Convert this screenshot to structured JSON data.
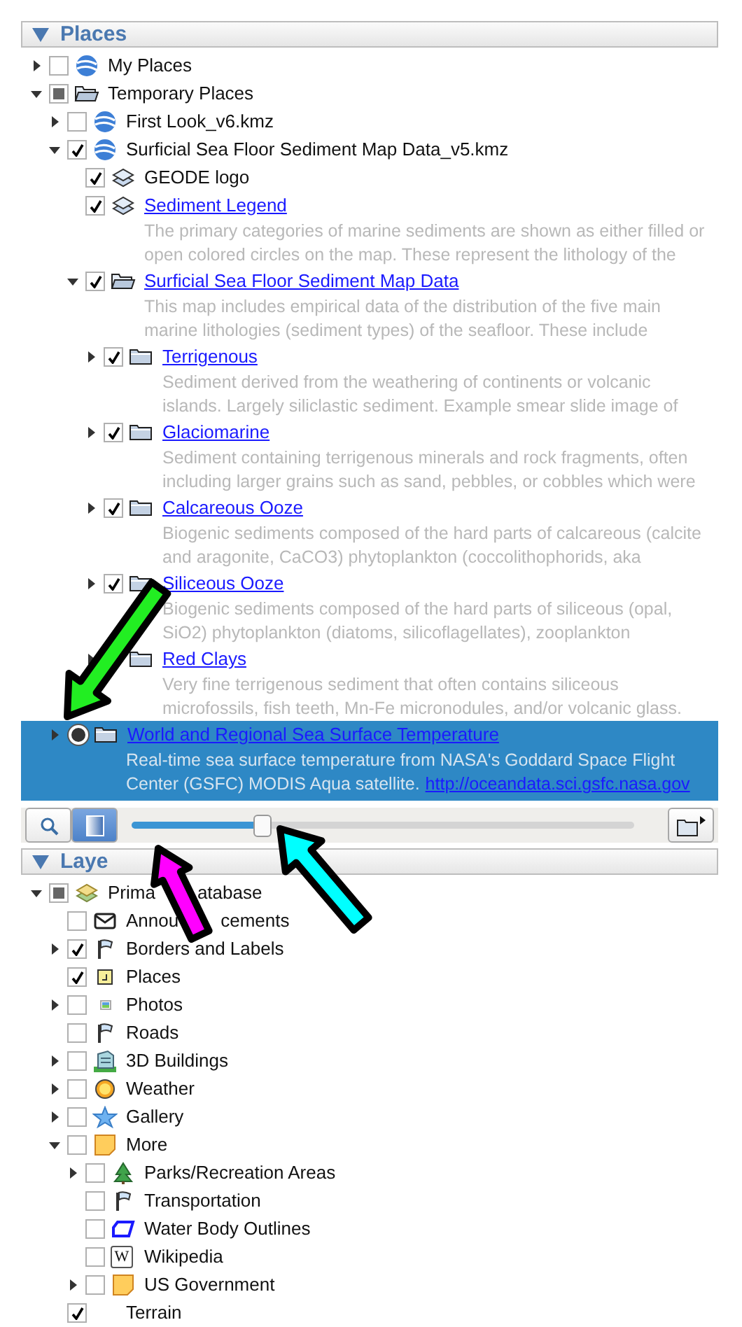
{
  "places": {
    "title": "Places",
    "expanded": true,
    "items": [
      {
        "label": "My Places",
        "kind": "globe",
        "expandable": true,
        "expanded": false,
        "checked": false,
        "link": false,
        "selected": false
      },
      {
        "label": "Temporary Places",
        "kind": "folder-open",
        "expandable": true,
        "expanded": true,
        "mixed": true,
        "link": false,
        "selected": false,
        "children": [
          {
            "label": "First Look_v6.kmz",
            "kind": "globe",
            "expandable": true,
            "expanded": false,
            "checked": false,
            "link": false,
            "selected": false
          },
          {
            "label": "Surficial Sea Floor Sediment Map Data_v5.kmz",
            "kind": "globe",
            "expandable": true,
            "expanded": true,
            "checked": true,
            "link": false,
            "selected": false,
            "children": [
              {
                "label": "GEODE logo",
                "kind": "layers",
                "expandable": false,
                "expanded": false,
                "checked": true,
                "link": false,
                "selected": false
              },
              {
                "label": "Sediment Legend",
                "kind": "layers",
                "expandable": false,
                "expanded": false,
                "checked": true,
                "link": true,
                "selected": false,
                "description": [
                  "The primary categories of marine sediments are shown as either filled or",
                  "open colored circles on the map. These represent the lithology of the"
                ]
              },
              {
                "label": "Surficial Sea Floor Sediment Map Data",
                "kind": "folder-open",
                "expandable": true,
                "expanded": true,
                "checked": true,
                "link": true,
                "selected": false,
                "description": [
                  "This map includes empirical data of the distribution of the five main",
                  "marine lithologies (sediment types) of the seafloor. These include"
                ],
                "children": [
                  {
                    "label": "Terrigenous",
                    "kind": "folder",
                    "expandable": true,
                    "expanded": false,
                    "checked": true,
                    "link": true,
                    "selected": false,
                    "description": [
                      "Sediment derived from the weathering of continents or volcanic",
                      "islands. Largely siliclastic sediment. Example smear slide image of"
                    ]
                  },
                  {
                    "label": "Glaciomarine",
                    "kind": "folder",
                    "expandable": true,
                    "expanded": false,
                    "checked": true,
                    "link": true,
                    "selected": false,
                    "description": [
                      "Sediment containing terrigenous minerals and rock fragments, often",
                      "including larger grains such as sand, pebbles, or cobbles which were"
                    ]
                  },
                  {
                    "label": "Calcareous Ooze",
                    "kind": "folder",
                    "expandable": true,
                    "expanded": false,
                    "checked": true,
                    "link": true,
                    "selected": false,
                    "description": [
                      "Biogenic sediments composed of the hard parts of calcareous (calcite",
                      "and aragonite, CaCO3) phytoplankton (coccolithophorids, aka"
                    ]
                  },
                  {
                    "label": "Siliceous Ooze",
                    "kind": "folder",
                    "expandable": true,
                    "expanded": false,
                    "checked": true,
                    "link": true,
                    "selected": false,
                    "description": [
                      "Biogenic sediments composed of the hard parts of siliceous (opal,",
                      "SiO2) phytoplankton (diatoms, silicoflagellates), zooplankton"
                    ]
                  },
                  {
                    "label": "Red Clays",
                    "kind": "folder",
                    "expandable": true,
                    "expanded": false,
                    "link": true,
                    "selected": false,
                    "description": [
                      "Very fine terrigenous sediment that often contains siliceous",
                      "microfossils, fish teeth, Mn-Fe micronodules, and/or volcanic glass."
                    ]
                  }
                ]
              }
            ]
          },
          {
            "label": "World and Regional Sea Surface Temperature",
            "kind": "folder",
            "expandable": true,
            "expanded": false,
            "checked": true,
            "radio": true,
            "link": true,
            "selected": true,
            "description": [
              "Real-time sea surface temperature from NASA's Goddard Space Flight",
              "Center (GSFC) MODIS Aqua satellite."
            ],
            "description_link": "http://oceandata.sci.gsfc.nasa.gov"
          }
        ]
      }
    ]
  },
  "toolbar": {
    "mode_buttons": [
      {
        "kind": "search",
        "selected": false
      },
      {
        "kind": "transparency",
        "selected": true
      }
    ],
    "slider": {
      "level": 0.26
    }
  },
  "layers": {
    "title": "Laye",
    "expanded": true,
    "items": [
      {
        "label_parts": [
          "Prima",
          "atabase"
        ],
        "kind": "database",
        "expandable": true,
        "expanded": true,
        "mixed": true,
        "link": false,
        "selected": false,
        "children": [
          {
            "label_parts": [
              "Annou",
              "cements"
            ],
            "kind": "envelope",
            "expandable": false,
            "expanded": false,
            "checked": false,
            "link": false,
            "selected": false
          },
          {
            "label": "Borders and Labels",
            "kind": "flag",
            "expandable": true,
            "expanded": false,
            "checked": true,
            "link": false,
            "selected": false
          },
          {
            "label": "Places",
            "kind": "place",
            "expandable": false,
            "expanded": false,
            "checked": true,
            "link": false,
            "selected": false
          },
          {
            "label": "Photos",
            "kind": "photo",
            "expandable": true,
            "expanded": false,
            "checked": false,
            "link": false,
            "selected": false
          },
          {
            "label": "Roads",
            "kind": "flag",
            "expandable": false,
            "expanded": false,
            "checked": false,
            "link": false,
            "selected": false
          },
          {
            "label": "3D Buildings",
            "kind": "building",
            "expandable": true,
            "expanded": false,
            "checked": false,
            "link": false,
            "selected": false
          },
          {
            "label": "Weather",
            "kind": "sun",
            "expandable": true,
            "expanded": false,
            "checked": false,
            "link": false,
            "selected": false
          },
          {
            "label": "Gallery",
            "kind": "star",
            "expandable": true,
            "expanded": false,
            "checked": false,
            "link": false,
            "selected": false
          },
          {
            "label": "More",
            "kind": "note",
            "expandable": true,
            "expanded": true,
            "checked": false,
            "link": false,
            "selected": false,
            "children": [
              {
                "label": "Parks/Recreation Areas",
                "kind": "tree",
                "expandable": true,
                "expanded": false,
                "checked": false,
                "link": false,
                "selected": false
              },
              {
                "label": "Transportation",
                "kind": "flag",
                "expandable": false,
                "expanded": false,
                "checked": false,
                "link": false,
                "selected": false
              },
              {
                "label": "Water Body Outlines",
                "kind": "outline",
                "expandable": false,
                "expanded": false,
                "checked": false,
                "link": false,
                "selected": false
              },
              {
                "label": "Wikipedia",
                "kind": "badge",
                "badge": "W",
                "expandable": false,
                "expanded": false,
                "checked": false,
                "link": false,
                "selected": false
              },
              {
                "label": "US Government",
                "kind": "note",
                "expandable": true,
                "expanded": false,
                "checked": false,
                "link": false,
                "selected": false
              }
            ]
          },
          {
            "label": "Terrain",
            "kind": "none",
            "expandable": false,
            "expanded": false,
            "checked": true,
            "link": false,
            "selected": false
          }
        ]
      }
    ]
  },
  "annotations": [
    {
      "kind": "arrow",
      "color": "#22ee22"
    },
    {
      "kind": "arrow",
      "color": "#ff00ff"
    },
    {
      "kind": "arrow",
      "color": "#00ffff"
    }
  ]
}
